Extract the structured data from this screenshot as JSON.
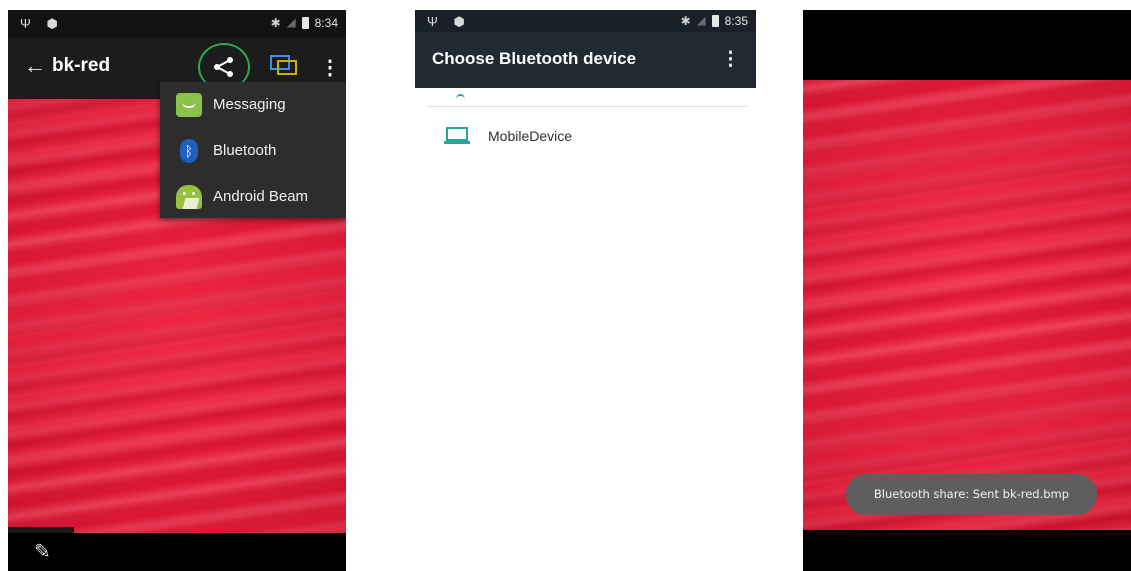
{
  "screen1": {
    "status": {
      "left_icons": "Ψ ⬢",
      "time": "8:34"
    },
    "title": "bk-red",
    "overflow_glyph": "⋮",
    "menu_items": [
      {
        "label": "Messaging",
        "icon": "messaging-icon",
        "color": "#8bc34a"
      },
      {
        "label": "Bluetooth",
        "icon": "bluetooth-icon",
        "color": "#2979ff"
      },
      {
        "label": "Android Beam",
        "icon": "android-icon",
        "color": "#97c03d"
      }
    ],
    "highlight_color": "#2ea84a",
    "cast_icon_color": "#3f8fe0"
  },
  "screen2": {
    "status": {
      "left_icons": "Ψ ⬢",
      "time": "8:35"
    },
    "title": "Choose Bluetooth device",
    "overflow_glyph": "⋮",
    "devices": [
      {
        "name": "MobileDevice",
        "icon": "laptop-icon",
        "icon_color": "#26a69a"
      }
    ]
  },
  "screen3": {
    "toast": "Bluetooth share: Sent bk-red.bmp"
  },
  "colors": {
    "accent_red": "#e81a38",
    "bar_dark": "#1c1c1c",
    "header2": "#212a33"
  }
}
